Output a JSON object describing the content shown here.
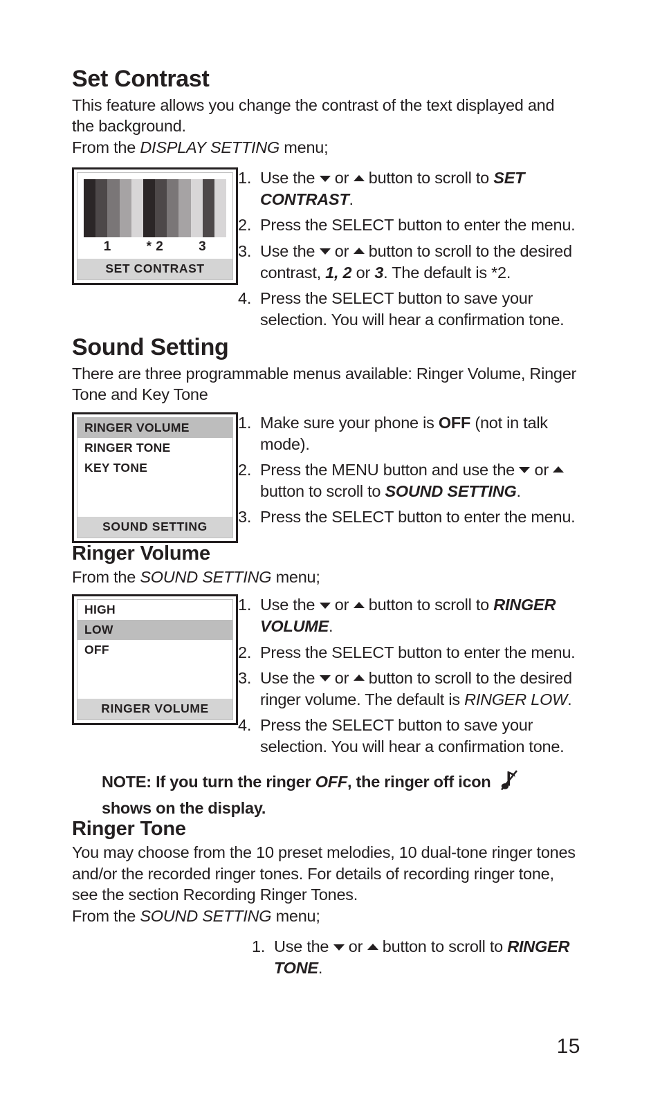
{
  "page": {
    "number": "15"
  },
  "set_contrast": {
    "heading": "Set Contrast",
    "intro": "This feature allows you change the contrast of the text displayed and the background.",
    "from_prefix": "From the ",
    "from_menu": "DISPLAY SETTING",
    "from_suffix": " menu;",
    "lcd": {
      "title": "SET CONTRAST",
      "bar_labels": [
        "1",
        "* 2",
        "3"
      ],
      "bar_colors": [
        "#2b2627",
        "#4d4849",
        "#7a7677",
        "#a6a3a4",
        "#d8d6d7",
        "#2b2627",
        "#4d4849",
        "#7a7677",
        "#a6a3a4",
        "#d8d6d7",
        "#4d4849",
        "#d8d6d7"
      ]
    },
    "steps": [
      {
        "num": "1.",
        "parts": [
          {
            "t": "Use the ",
            "s": "plain"
          },
          {
            "t": "arrow-down",
            "s": "icon"
          },
          {
            "t": " or ",
            "s": "plain"
          },
          {
            "t": "arrow-up",
            "s": "icon"
          },
          {
            "t": "  button to scroll to ",
            "s": "plain"
          },
          {
            "t": "SET CONTRAST",
            "s": "bolditalic"
          },
          {
            "t": ".",
            "s": "plain"
          }
        ]
      },
      {
        "num": "2.",
        "parts": [
          {
            "t": "Press the SELECT button to enter the menu.",
            "s": "plain"
          }
        ]
      },
      {
        "num": "3.",
        "parts": [
          {
            "t": "Use the ",
            "s": "plain"
          },
          {
            "t": "arrow-down",
            "s": "icon"
          },
          {
            "t": " or ",
            "s": "plain"
          },
          {
            "t": "arrow-up",
            "s": "icon"
          },
          {
            "t": "  button to scroll to the desired contrast, ",
            "s": "plain"
          },
          {
            "t": "1, 2",
            "s": "bolditalic"
          },
          {
            "t": " or ",
            "s": "plain"
          },
          {
            "t": "3",
            "s": "bolditalic"
          },
          {
            "t": ". The default is *2.",
            "s": "plain"
          }
        ]
      },
      {
        "num": "4.",
        "parts": [
          {
            "t": "Press the SELECT button to save your selection. You will hear a confirmation tone.",
            "s": "plain"
          }
        ]
      }
    ]
  },
  "sound_setting": {
    "heading": "Sound Setting",
    "intro": "There are three programmable menus available: Ringer Volume, Ringer Tone and Key Tone",
    "lcd": {
      "title": "SOUND SETTING",
      "rows": [
        {
          "label": "RINGER VOLUME",
          "selected": true
        },
        {
          "label": "RINGER TONE",
          "selected": false
        },
        {
          "label": "KEY TONE",
          "selected": false
        }
      ]
    },
    "steps": [
      {
        "num": "1.",
        "parts": [
          {
            "t": "Make sure your phone is ",
            "s": "plain"
          },
          {
            "t": "OFF",
            "s": "bold"
          },
          {
            "t": " (not in talk mode).",
            "s": "plain"
          }
        ]
      },
      {
        "num": "2.",
        "parts": [
          {
            "t": "Press the MENU button and use the ",
            "s": "plain"
          },
          {
            "t": "arrow-down",
            "s": "icon"
          },
          {
            "t": " or ",
            "s": "plain"
          },
          {
            "t": "arrow-up",
            "s": "icon"
          },
          {
            "t": " button to scroll to ",
            "s": "plain"
          },
          {
            "t": "SOUND SETTING",
            "s": "bolditalic"
          },
          {
            "t": ".",
            "s": "plain"
          }
        ]
      },
      {
        "num": "3.",
        "parts": [
          {
            "t": "Press the SELECT button to enter the menu.",
            "s": "plain"
          }
        ]
      }
    ]
  },
  "ringer_volume": {
    "heading": "Ringer Volume",
    "from_prefix": "From the ",
    "from_menu": "SOUND SETTING",
    "from_suffix": " menu;",
    "lcd": {
      "title": "RINGER VOLUME",
      "rows": [
        {
          "label": "HIGH",
          "selected": false
        },
        {
          "label": "LOW",
          "selected": true
        },
        {
          "label": "OFF",
          "selected": false
        }
      ]
    },
    "steps": [
      {
        "num": "1.",
        "parts": [
          {
            "t": "Use the ",
            "s": "plain"
          },
          {
            "t": "arrow-down",
            "s": "icon"
          },
          {
            "t": " or ",
            "s": "plain"
          },
          {
            "t": "arrow-up",
            "s": "icon"
          },
          {
            "t": "  button to scroll to ",
            "s": "plain"
          },
          {
            "t": "RINGER VOLUME",
            "s": "bolditalic"
          },
          {
            "t": ".",
            "s": "plain"
          }
        ]
      },
      {
        "num": "2.",
        "parts": [
          {
            "t": "Press the SELECT button to enter the menu.",
            "s": "plain"
          }
        ]
      },
      {
        "num": "3.",
        "parts": [
          {
            "t": "Use the ",
            "s": "plain"
          },
          {
            "t": "arrow-down",
            "s": "icon"
          },
          {
            "t": " or ",
            "s": "plain"
          },
          {
            "t": "arrow-up",
            "s": "icon"
          },
          {
            "t": "  button to scroll to the desired ringer volume. The default is ",
            "s": "plain"
          },
          {
            "t": "RINGER LOW",
            "s": "italic"
          },
          {
            "t": ".",
            "s": "plain"
          }
        ]
      },
      {
        "num": "4.",
        "parts": [
          {
            "t": "Press the SELECT button to save your selection. You will hear a confirmation tone.",
            "s": "plain"
          }
        ]
      }
    ],
    "note": {
      "prefix": "NOTE: If you turn the ringer ",
      "emphasis": "OFF",
      "middle": ", the ringer off icon ",
      "icon": "ringer-off-icon",
      "suffix": "shows on the display."
    }
  },
  "ringer_tone": {
    "heading": "Ringer Tone",
    "intro": "You may choose from the 10 preset melodies, 10 dual-tone ringer tones and/or the recorded ringer tones. For details of recording ringer tone, see the section Recording Ringer Tones.",
    "from_prefix": "From the ",
    "from_menu": "SOUND SETTING",
    "from_suffix": " menu;",
    "steps": [
      {
        "num": "1.",
        "parts": [
          {
            "t": "Use the ",
            "s": "plain"
          },
          {
            "t": "arrow-down",
            "s": "icon"
          },
          {
            "t": " or ",
            "s": "plain"
          },
          {
            "t": "arrow-up",
            "s": "icon"
          },
          {
            "t": "  button to scroll to ",
            "s": "plain"
          },
          {
            "t": "RINGER TONE",
            "s": "bolditalic"
          },
          {
            "t": ".",
            "s": "plain"
          }
        ]
      }
    ]
  }
}
